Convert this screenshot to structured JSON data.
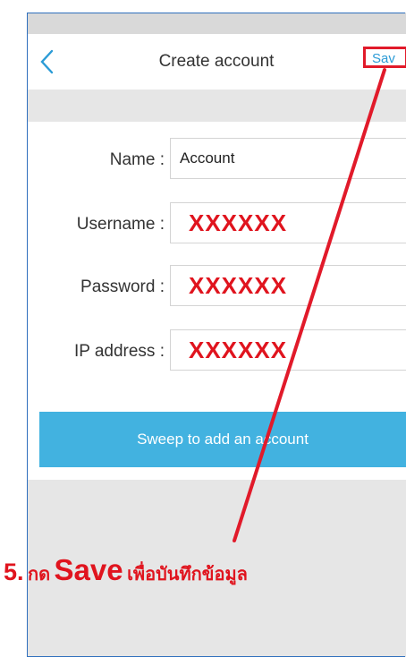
{
  "header": {
    "title": "Create account",
    "save_label": "Sav"
  },
  "form": {
    "fields": [
      {
        "label": "Name :",
        "value": "Account"
      },
      {
        "label": "Username :",
        "value": "XXXXXX"
      },
      {
        "label": "Password :",
        "value": "XXXXXX"
      },
      {
        "label": "IP address :",
        "value": "XXXXXX"
      }
    ],
    "submit_label": "Sweep to add an account"
  },
  "annotation": {
    "step": "5.",
    "verb": "กด",
    "keyword": "Save",
    "rest": "เพื่อบันทึกข้อมูล"
  },
  "colors": {
    "accent": "#42b2e0",
    "link": "#2b9bd6",
    "annotation_red": "#e0141e"
  },
  "icons": {
    "back": "chevron-left-icon"
  }
}
